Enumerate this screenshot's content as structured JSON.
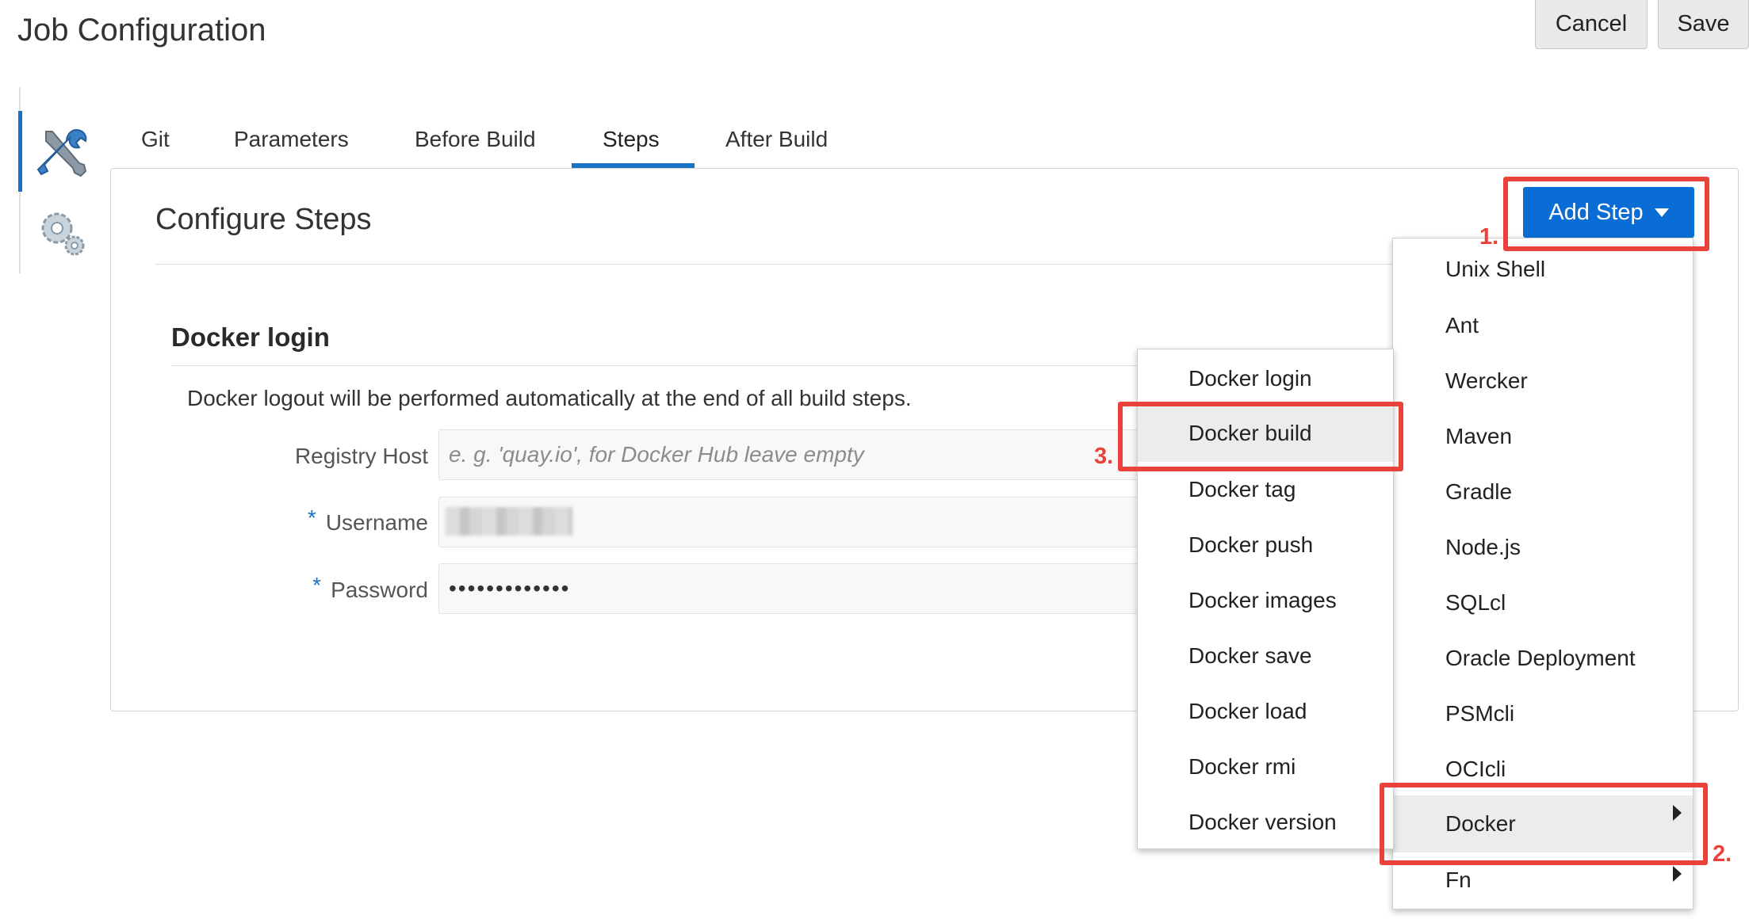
{
  "header": {
    "title": "Job Configuration",
    "cancel_label": "Cancel",
    "save_label": "Save"
  },
  "side_tabs": [
    {
      "icon": "tools-icon",
      "active": true
    },
    {
      "icon": "gears-icon",
      "active": false
    }
  ],
  "tabs": [
    {
      "label": "Git"
    },
    {
      "label": "Parameters"
    },
    {
      "label": "Before Build"
    },
    {
      "label": "Steps",
      "active": true
    },
    {
      "label": "After Build"
    }
  ],
  "section": {
    "title": "Configure Steps",
    "add_step_label": "Add Step"
  },
  "docker_login": {
    "title": "Docker login",
    "note": "Docker logout will be performed automatically at the end of all build steps.",
    "registry_host_label": "Registry Host",
    "registry_host_placeholder": "e. g. 'quay.io', for Docker Hub leave empty",
    "username_label": "Username",
    "password_label": "Password",
    "password_value": "•••••••••••••",
    "required_marker": "*"
  },
  "add_step_menu": {
    "items": [
      {
        "label": "Unix Shell"
      },
      {
        "label": "Ant"
      },
      {
        "label": "Wercker"
      },
      {
        "label": "Maven"
      },
      {
        "label": "Gradle"
      },
      {
        "label": "Node.js"
      },
      {
        "label": "SQLcl"
      },
      {
        "label": "Oracle Deployment"
      },
      {
        "label": "PSMcli"
      },
      {
        "label": "OCIcli"
      },
      {
        "label": "Docker",
        "submenu": true,
        "highlighted": true
      },
      {
        "label": "Fn",
        "submenu": true
      }
    ]
  },
  "docker_submenu": {
    "items": [
      {
        "label": "Docker login"
      },
      {
        "label": "Docker build",
        "highlighted": true
      },
      {
        "label": "Docker tag"
      },
      {
        "label": "Docker push"
      },
      {
        "label": "Docker images"
      },
      {
        "label": "Docker save"
      },
      {
        "label": "Docker load"
      },
      {
        "label": "Docker rmi"
      },
      {
        "label": "Docker version"
      }
    ]
  },
  "annotations": {
    "step1": "1.",
    "step2": "2.",
    "step3": "3."
  },
  "colors": {
    "accent": "#0a6dd5",
    "annotation_red": "#e8423a",
    "tab_underline": "#1a72c4"
  }
}
